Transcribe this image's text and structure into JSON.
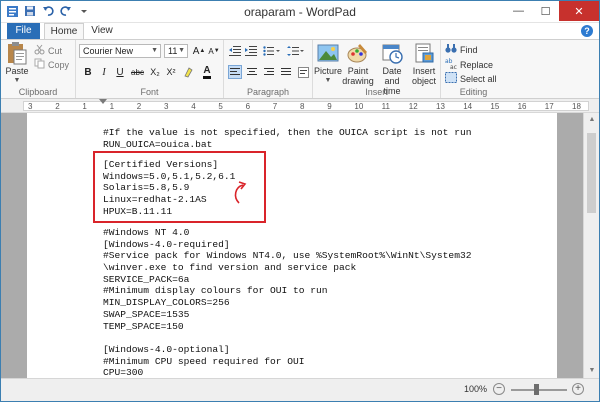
{
  "window": {
    "title": "oraparam - WordPad",
    "buttons": {
      "minimize": "—",
      "maximize": "☐",
      "close": "✕"
    }
  },
  "tabs": {
    "file": "File",
    "home": "Home",
    "view": "View"
  },
  "ribbon": {
    "clipboard": {
      "label": "Clipboard",
      "paste": "Paste",
      "cut": "Cut",
      "copy": "Copy"
    },
    "font": {
      "label": "Font",
      "family": "Courier New",
      "size": "11",
      "bold": "B",
      "italic": "I",
      "underline": "U",
      "strike": "abc",
      "subscript": "X₂",
      "superscript": "X²"
    },
    "paragraph": {
      "label": "Paragraph"
    },
    "insert": {
      "label": "Insert",
      "picture": "Picture",
      "paint_drawing_1": "Paint",
      "paint_drawing_2": "drawing",
      "date_time_1": "Date and",
      "date_time_2": "time",
      "insert_object_1": "Insert",
      "insert_object_2": "object"
    },
    "editing": {
      "label": "Editing",
      "find": "Find",
      "replace": "Replace",
      "select_all": "Select all"
    }
  },
  "ruler": {
    "numbers": [
      "3",
      "2",
      "1",
      "1",
      "2",
      "3",
      "4",
      "5",
      "6",
      "7",
      "8",
      "9",
      "10",
      "11",
      "12",
      "13",
      "14",
      "15",
      "16",
      "17",
      "18"
    ]
  },
  "document": {
    "lines_top": [
      "#If the value is not specified, then the OUICA script is not run",
      "RUN_OUICA=ouica.bat"
    ],
    "lines_boxed": [
      "[Certified Versions]",
      "Windows=5.0,5.1,5.2,6.1",
      "Solaris=5.8,5.9",
      "Linux=redhat-2.1AS",
      "HPUX=B.11.11"
    ],
    "lines_bottom": [
      "#Windows NT 4.0",
      "[Windows-4.0-required]",
      "#Service pack for Windows NT4.0, use %SystemRoot%\\WinNt\\System32",
      "\\winver.exe to find version and service pack",
      "SERVICE_PACK=6a",
      "#Minimum display colours for OUI to run",
      "MIN_DISPLAY_COLORS=256",
      "SWAP_SPACE=1535",
      "TEMP_SPACE=150",
      "",
      "[Windows-4.0-optional]",
      "#Minimum CPU speed required for OUI",
      "CPU=300"
    ]
  },
  "statusbar": {
    "zoom": "100%",
    "zoom_out": "−",
    "zoom_in": "+"
  },
  "colors": {
    "accent": "#2a6eb7",
    "highlight_box": "#d9242a",
    "close_button": "#c7312d"
  }
}
